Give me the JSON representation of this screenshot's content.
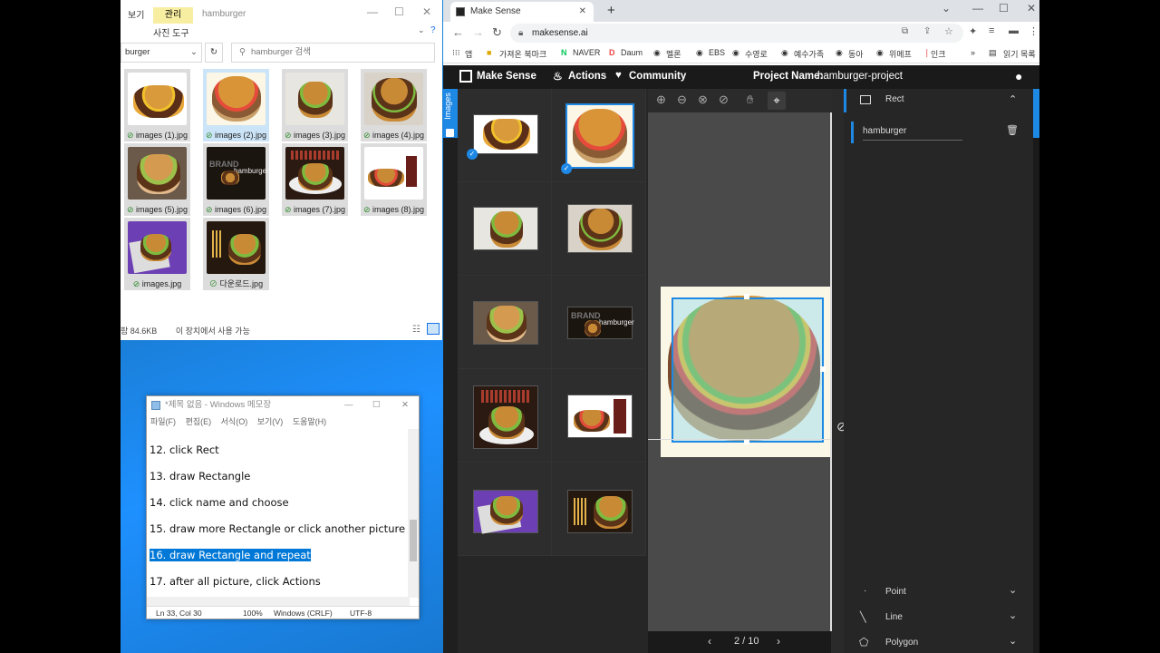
{
  "explorer": {
    "manage_tab": "관리",
    "view_tab": "보기",
    "tools_tab": "사진 도구",
    "title": "hamburger",
    "address": "burger",
    "search_placeholder": "hamburger 검색",
    "files": [
      {
        "name": "images (1).jpg"
      },
      {
        "name": "images (2).jpg"
      },
      {
        "name": "images (3).jpg"
      },
      {
        "name": "images (4).jpg"
      },
      {
        "name": "images (5).jpg"
      },
      {
        "name": "images (6).jpg"
      },
      {
        "name": "images (7).jpg"
      },
      {
        "name": "images (8).jpg"
      },
      {
        "name": "images.jpg"
      },
      {
        "name": "다운로드.jpg"
      }
    ],
    "status_size": "팜 84.6KB",
    "status_avail": "이 장치에서 사용 가능"
  },
  "notepad": {
    "title": "*제목 없음 - Windows 메모장",
    "menu": [
      "파일(F)",
      "편집(E)",
      "서식(O)",
      "보기(V)",
      "도움말(H)"
    ],
    "lines": [
      "12. click Rect",
      "13. draw Rectangle",
      "14. click name and choose",
      "15. draw more Rectangle or click another picture",
      "16. draw Rectangle and repeat",
      "17. after all picture, click Actions"
    ],
    "status": {
      "pos": "Ln 33, Col 30",
      "zoom": "100%",
      "eol": "Windows (CRLF)",
      "enc": "UTF-8"
    }
  },
  "browser": {
    "tab_title": "Make Sense",
    "url": "makesense.ai",
    "bookmarks": [
      "앱",
      "가져온 북마크",
      "NAVER",
      "Daum",
      "멜론",
      "EBS",
      "수영로",
      "예수가족",
      "동아",
      "위메프",
      "인크",
      "읽기 목록"
    ]
  },
  "makesense": {
    "brand": "Make Sense",
    "actions": "Actions",
    "community": "Community",
    "project_label": "Project Name:",
    "project_name": "hamburger-project",
    "images_tab": "Images",
    "page": "2 / 10",
    "tools": {
      "rect": "Rect",
      "point": "Point",
      "line": "Line",
      "polygon": "Polygon"
    },
    "label_name": "hamburger"
  },
  "colors": {
    "accent": "#1e88e5",
    "panel": "#262626",
    "nav": "#1a1a1a"
  }
}
